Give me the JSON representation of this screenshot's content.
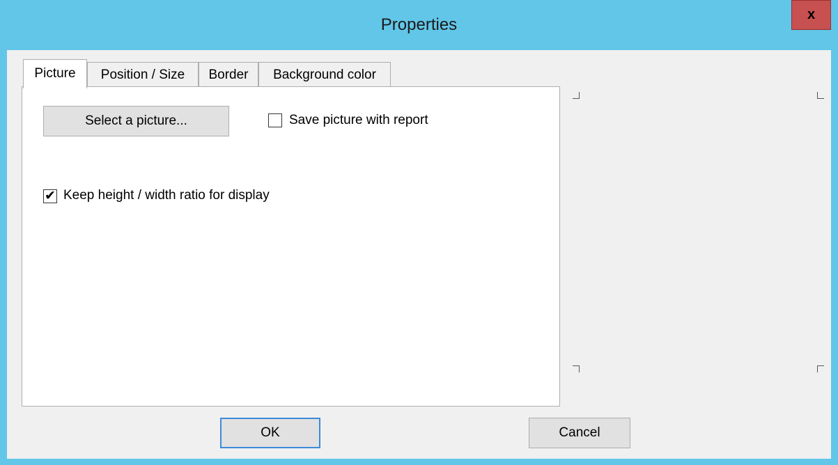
{
  "window": {
    "title": "Properties",
    "close_glyph": "x"
  },
  "tabs": [
    {
      "label": "Picture",
      "active": true
    },
    {
      "label": "Position / Size",
      "active": false
    },
    {
      "label": "Border",
      "active": false
    },
    {
      "label": "Background color",
      "active": false
    }
  ],
  "picture_tab": {
    "select_button_label": "Select a picture...",
    "save_with_report": {
      "label": "Save picture with report",
      "checked": false
    },
    "keep_ratio": {
      "label": "Keep height / width ratio for display",
      "checked": true
    }
  },
  "footer": {
    "ok_label": "OK",
    "cancel_label": "Cancel"
  },
  "icons": {
    "check_glyph": "✔"
  },
  "colors": {
    "title_bar": "#62c6e8",
    "close_button": "#c75050",
    "default_button_border": "#3c8ad8"
  }
}
